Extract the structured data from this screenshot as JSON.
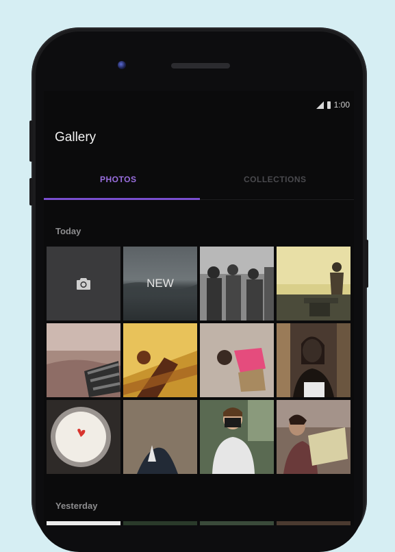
{
  "status_bar": {
    "time": "1:00"
  },
  "app": {
    "title": "Gallery"
  },
  "tabs": [
    {
      "label": "PHOTOS",
      "active": true
    },
    {
      "label": "COLLECTIONS",
      "active": false
    }
  ],
  "sections": {
    "today": "Today",
    "yesterday": "Yesterday"
  },
  "grid": {
    "camera_icon": "camera-icon",
    "new_label": "NEW"
  },
  "colors": {
    "accent": "#7a4fd0",
    "background": "#0b0b0c",
    "camera_tile": "#3a3a3c"
  }
}
